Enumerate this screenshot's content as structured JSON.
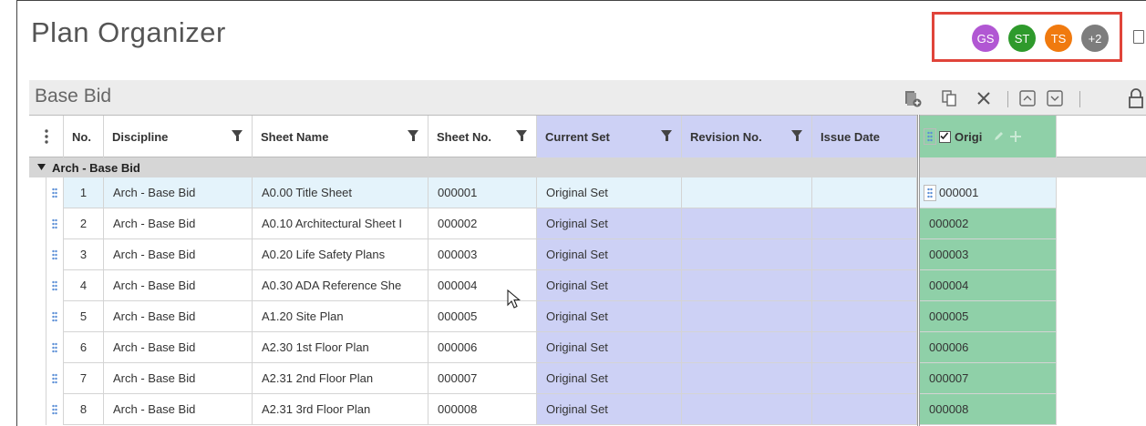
{
  "app": {
    "title": "Plan Organizer"
  },
  "users": [
    {
      "initials": "GS",
      "color": "#b157d3"
    },
    {
      "initials": "ST",
      "color": "#2e9a2c"
    },
    {
      "initials": "TS",
      "color": "#f07a0f"
    },
    {
      "initials": "+2",
      "color": "#7d7d7d"
    }
  ],
  "sheet": {
    "title": "Base Bid"
  },
  "toolbar": {
    "icons": [
      "add-sheet-icon",
      "copy-icon",
      "close-icon",
      "collapse-icon",
      "expand-icon",
      "lock-icon"
    ]
  },
  "table": {
    "columns": {
      "no": "No.",
      "discipline": "Discipline",
      "sheet_name": "Sheet Name",
      "sheet_no": "Sheet No.",
      "current_set": "Current Set",
      "revision_no": "Revision No.",
      "issue_date": "Issue Date",
      "original": "Origi"
    },
    "group_label": "Arch - Base Bid",
    "rows": [
      {
        "no": "1",
        "discipline": "Arch - Base Bid",
        "sheet_name": "A0.00 Title Sheet",
        "sheet_no": "000001",
        "current_set": "Original Set",
        "original": "000001"
      },
      {
        "no": "2",
        "discipline": "Arch - Base Bid",
        "sheet_name": "A0.10 Architectural Sheet I",
        "sheet_no": "000002",
        "current_set": "Original Set",
        "original": "000002"
      },
      {
        "no": "3",
        "discipline": "Arch - Base Bid",
        "sheet_name": "A0.20 Life Safety Plans",
        "sheet_no": "000003",
        "current_set": "Original Set",
        "original": "000003"
      },
      {
        "no": "4",
        "discipline": "Arch - Base Bid",
        "sheet_name": "A0.30 ADA Reference She",
        "sheet_no": "000004",
        "current_set": "Original Set",
        "original": "000004"
      },
      {
        "no": "5",
        "discipline": "Arch - Base Bid",
        "sheet_name": "A1.20 Site Plan",
        "sheet_no": "000005",
        "current_set": "Original Set",
        "original": "000005"
      },
      {
        "no": "6",
        "discipline": "Arch - Base Bid",
        "sheet_name": "A2.30 1st Floor Plan",
        "sheet_no": "000006",
        "current_set": "Original Set",
        "original": "000006"
      },
      {
        "no": "7",
        "discipline": "Arch - Base Bid",
        "sheet_name": "A2.31 2nd Floor Plan",
        "sheet_no": "000007",
        "current_set": "Original Set",
        "original": "000007"
      },
      {
        "no": "8",
        "discipline": "Arch - Base Bid",
        "sheet_name": "A2.31 3rd Floor Plan",
        "sheet_no": "000008",
        "current_set": "Original Set",
        "original": "000008"
      }
    ]
  },
  "colors": {
    "current_set_column": "#cdd1f5",
    "original_column": "#8fd0a8",
    "highlight_box": "#e0443a"
  }
}
